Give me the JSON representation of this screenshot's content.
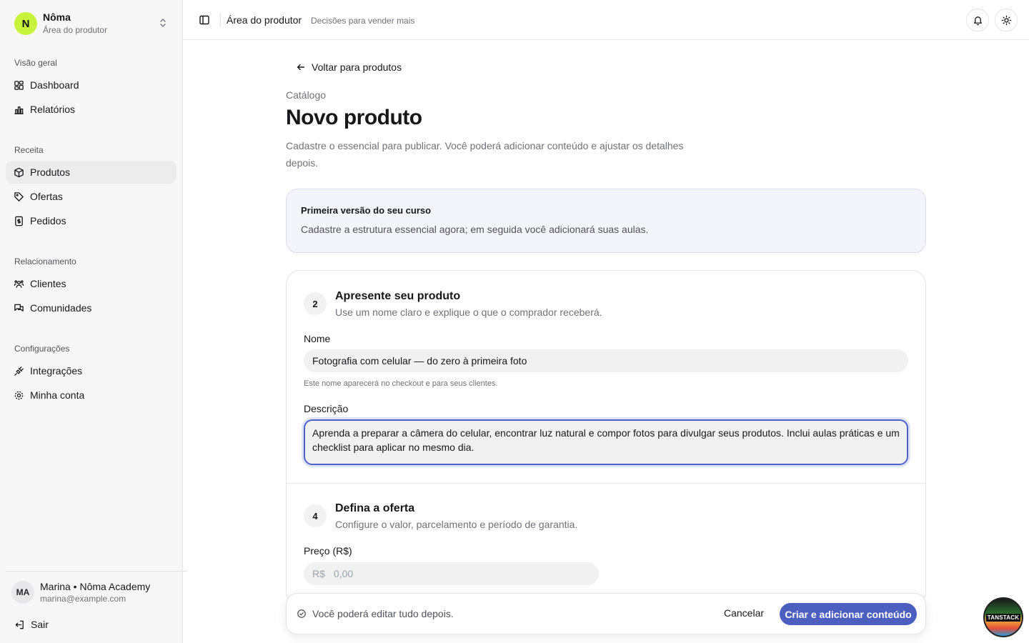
{
  "brand": {
    "initial": "N",
    "name": "Nôma",
    "subtitle": "Área do produtor",
    "accent": "#c7f43a"
  },
  "sidebar": {
    "groups": [
      {
        "label": "Visão geral",
        "items": [
          {
            "label": "Dashboard",
            "icon": "dashboard-icon"
          },
          {
            "label": "Relatórios",
            "icon": "bar-chart-icon"
          }
        ]
      },
      {
        "label": "Receita",
        "items": [
          {
            "label": "Produtos",
            "icon": "package-icon",
            "active": true
          },
          {
            "label": "Ofertas",
            "icon": "tag-icon"
          },
          {
            "label": "Pedidos",
            "icon": "receipt-icon"
          }
        ]
      },
      {
        "label": "Relacionamento",
        "items": [
          {
            "label": "Clientes",
            "icon": "users-icon"
          },
          {
            "label": "Comunidades",
            "icon": "chat-icon"
          }
        ]
      },
      {
        "label": "Configurações",
        "items": [
          {
            "label": "Integrações",
            "icon": "plug-icon"
          },
          {
            "label": "Minha conta",
            "icon": "gear-icon"
          }
        ]
      }
    ],
    "user": {
      "initials": "MA",
      "name": "Marina • Nôma Academy",
      "email": "marina@example.com"
    },
    "logout_label": "Sair"
  },
  "header": {
    "title": "Área do produtor",
    "subtitle": "Decisões para vender mais"
  },
  "main": {
    "back_label": "Voltar para produtos",
    "eyebrow": "Catálogo",
    "title": "Novo produto",
    "description": "Cadastre o essencial para publicar. Você poderá adicionar conteúdo e ajustar os detalhes depois.",
    "info": {
      "title": "Primeira versão do seu curso",
      "text": "Cadastre a estrutura essencial agora; em seguida você adicionará suas aulas."
    },
    "step_intro": {
      "number": "2",
      "title": "Apresente seu produto",
      "subtitle": "Use um nome claro e explique o que o comprador receberá.",
      "name_label": "Nome",
      "name_value": "Fotografia com celular — do zero à primeira foto",
      "name_hint": "Este nome aparecerá no checkout e para seus clientes.",
      "description_label": "Descrição",
      "description_value": "Aprenda a preparar a câmera do celular, encontrar luz natural e compor fotos para divulgar seus produtos. Inclui aulas práticas e um checklist para aplicar no mesmo dia."
    },
    "step_offer": {
      "number": "4",
      "title": "Defina a oferta",
      "subtitle": "Configure o valor, parcelamento e período de garantia.",
      "price_label": "Preço (R$)",
      "price_prefix": "R$",
      "price_placeholder": "0,00"
    },
    "footer": {
      "note": "Você poderá editar tudo depois.",
      "cancel_label": "Cancelar",
      "submit_label": "Criar e adicionar conteúdo",
      "primary_color": "#4c5fc1"
    }
  },
  "badge": {
    "label": "TANSTACK"
  }
}
